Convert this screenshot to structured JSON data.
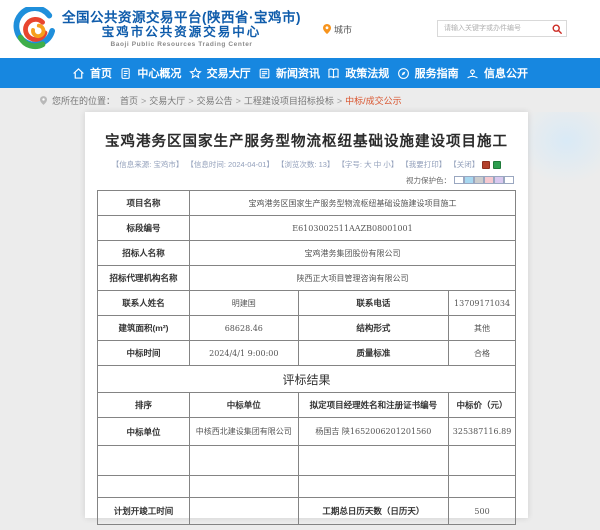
{
  "colors": {
    "nav_blue": "#1787e0",
    "header_blue": "#0f5cab",
    "accent_red": "#d9542e",
    "search_icon_red": "#cc2b24",
    "pin_orange": "#f7941d",
    "meta_text": "#93a0bb"
  },
  "header": {
    "title_line1": "全国公共资源交易平台(陕西省·宝鸡市)",
    "title_line2": "宝鸡市公共资源交易中心",
    "title_en": "Baoji Public Resources Trading Center",
    "city_label": "城市",
    "search_placeholder": "请输入关键字或办件编号"
  },
  "nav": {
    "items": [
      {
        "label": "首页"
      },
      {
        "label": "中心概况"
      },
      {
        "label": "交易大厅"
      },
      {
        "label": "新闻资讯"
      },
      {
        "label": "政策法规"
      },
      {
        "label": "服务指南"
      },
      {
        "label": "信息公开"
      }
    ]
  },
  "breadcrumb": {
    "prefix": "您所在的位置：",
    "separator": ">",
    "items": [
      "首页",
      "交易大厅",
      "交易公告",
      "工程建设项目招标投标",
      "中标/成交公示"
    ]
  },
  "article": {
    "title": "宝鸡港务区国家生产服务型物流枢纽基础设施建设项目施工",
    "meta": [
      "【信息来源: 宝鸡市】",
      "【信息时间: 2024-04-01】",
      "【浏览次数: 13】",
      "【字号: 大 中 小】",
      "【我要打印】",
      "【关闭】"
    ],
    "eye_protect_label": "视力保护色：",
    "eye_colors": [
      "#ffffff",
      "#a8d8f0",
      "#cdcdcd",
      "#f6c9d0",
      "#d9c9ef",
      "#ffffff"
    ]
  },
  "table": {
    "r_project": {
      "k": "项目名称",
      "v": "宝鸡港务区国家生产服务型物流枢纽基础设施建设项目施工"
    },
    "r_section": {
      "k": "标段编号",
      "v": "E6103002511AAZB08001001"
    },
    "r_tenderee": {
      "k": "招标人名称",
      "v": "宝鸡港务集团股份有限公司"
    },
    "r_agency": {
      "k": "招标代理机构名称",
      "v": "陕西正大项目管理咨询有限公司"
    },
    "r_contact": {
      "k": "联系人姓名",
      "v": "明建国",
      "k2": "联系电话",
      "v2": "13709171034"
    },
    "r_area": {
      "k": "建筑面积(m²)",
      "v": "68628.46",
      "k2": "结构形式",
      "v2": "其他"
    },
    "r_award_time": {
      "k": "中标时间",
      "v": "2024/4/1 9:00:00",
      "k2": "质量标准",
      "v2": "合格"
    },
    "section_title": "评标结果",
    "result_header": {
      "c1": "排序",
      "c2": "中标单位",
      "c3": "拟定项目经理姓名和注册证书编号",
      "c4": "中标价（元）"
    },
    "r_result": {
      "c1": "中标单位",
      "c2": "中核西北建设集团有限公司",
      "c3": "杨国吉 陕1652006201201560",
      "c4": "325387116.89"
    },
    "r_plan": {
      "k": "计划开竣工时间",
      "v": "",
      "k2": "工期总日历天数（日历天）",
      "v2": "500"
    }
  }
}
